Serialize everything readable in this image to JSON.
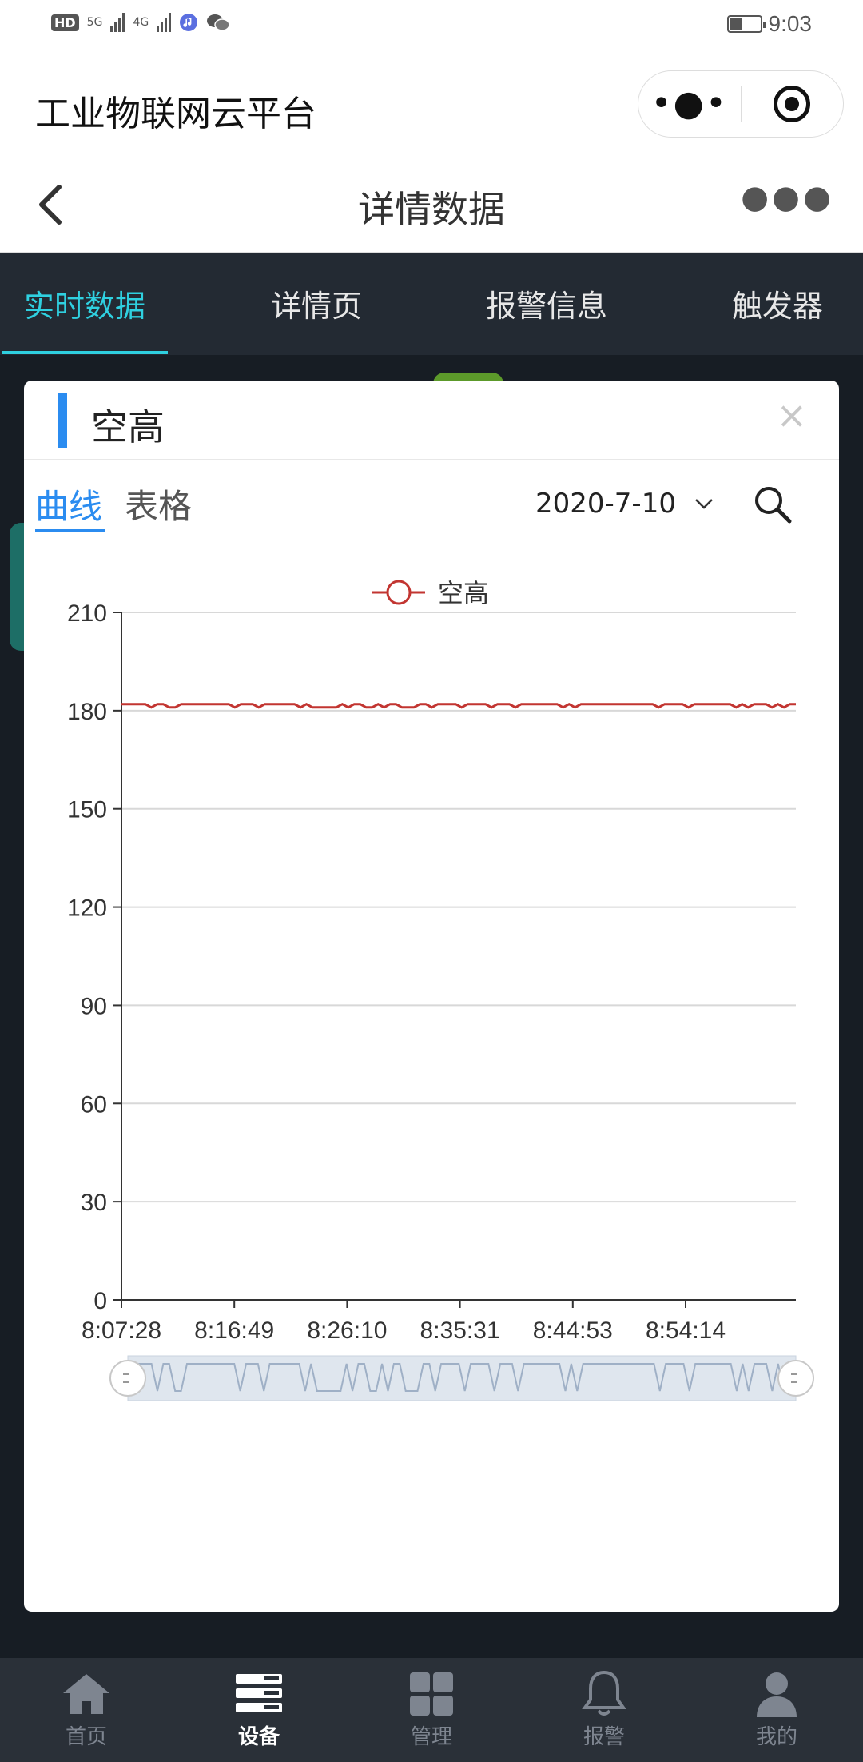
{
  "status_bar": {
    "network_badge": "HD",
    "signal_1": "5G",
    "signal_2": "4G",
    "time": "9:03"
  },
  "app": {
    "title": "工业物联网云平台",
    "menu_icon": "more-dots-icon",
    "target_icon": "target-circle-icon"
  },
  "nav": {
    "title": "详情数据",
    "back_icon": "chevron-left-icon",
    "more_icon": "ellipsis-icon"
  },
  "tabs": [
    {
      "label": "实时数据",
      "active": true
    },
    {
      "label": "详情页",
      "active": false
    },
    {
      "label": "报警信息",
      "active": false
    },
    {
      "label": "触发器",
      "active": false
    }
  ],
  "modal": {
    "title": "空高",
    "close_label": "×",
    "subtabs": [
      {
        "label": "曲线",
        "active": true
      },
      {
        "label": "表格",
        "active": false
      }
    ],
    "date": "2020-7-10"
  },
  "chart_data": {
    "type": "line",
    "legend": [
      "空高"
    ],
    "series": [
      {
        "name": "空高",
        "color": "#c23531",
        "values": [
          182,
          182,
          182,
          182,
          182,
          181,
          182,
          182,
          181,
          181,
          182,
          182,
          182,
          182,
          182,
          182,
          182,
          182,
          182,
          181,
          182,
          182,
          182,
          181,
          182,
          182,
          182,
          182,
          182,
          182,
          181,
          182,
          181,
          181,
          181,
          181,
          181,
          182,
          181,
          182,
          182,
          181,
          181,
          182,
          181,
          182,
          182,
          181,
          181,
          181,
          182,
          182,
          181,
          182,
          182,
          182,
          182,
          181,
          182,
          182,
          182,
          182,
          181,
          182,
          182,
          182,
          181,
          182,
          182,
          182,
          182,
          182,
          182,
          182,
          181,
          182,
          181,
          182,
          182,
          182,
          182,
          182,
          182,
          182,
          182,
          182,
          182,
          182,
          182,
          182,
          181,
          182,
          182,
          182,
          182,
          181,
          182,
          182,
          182,
          182,
          182,
          182,
          182,
          181,
          182,
          181,
          182,
          182,
          182,
          181,
          182,
          181,
          182,
          182
        ]
      }
    ],
    "x_tick_labels": [
      "8:07:28",
      "8:16:49",
      "8:26:10",
      "8:35:31",
      "8:44:53",
      "8:54:14"
    ],
    "y_ticks": [
      0,
      30,
      60,
      90,
      120,
      150,
      180,
      210
    ],
    "ylim": [
      0,
      210
    ],
    "grid": true,
    "legend_position": "top-center",
    "datazoom_slider": true
  },
  "bottom_nav": [
    {
      "label": "首页",
      "icon": "home-icon",
      "active": false
    },
    {
      "label": "设备",
      "icon": "device-list-icon",
      "active": true
    },
    {
      "label": "管理",
      "icon": "grid-icon",
      "active": false
    },
    {
      "label": "报警",
      "icon": "bell-icon",
      "active": false
    },
    {
      "label": "我的",
      "icon": "user-icon",
      "active": false
    }
  ],
  "colors": {
    "accent_blue": "#2b8cf0",
    "tab_active": "#2fd0e0",
    "tab_bar_bg": "#232a33",
    "page_dark_bg": "#171d24",
    "bottom_nav_bg": "#2a3038",
    "series_red": "#c23531"
  }
}
